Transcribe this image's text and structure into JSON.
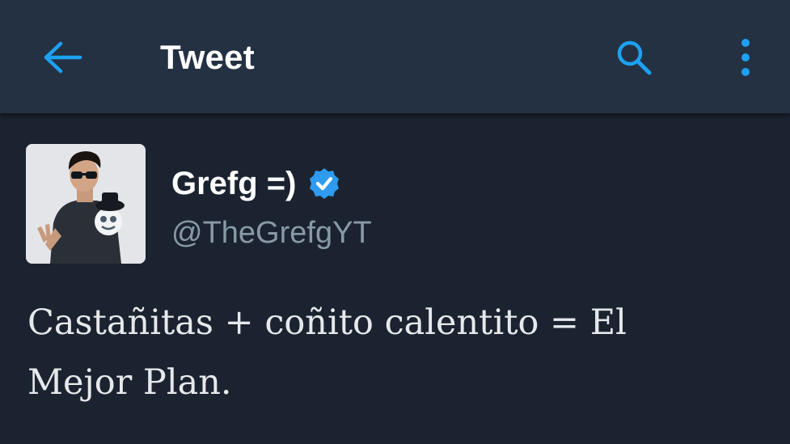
{
  "header": {
    "back_icon": "arrow-left-icon",
    "title": "Tweet",
    "search_icon": "search-icon",
    "more_icon": "vertical-dots-icon"
  },
  "tweet": {
    "author": {
      "display_name": "Grefg =)",
      "handle": "@TheGrefgYT",
      "verified": true,
      "verified_icon": "verified-badge-icon"
    },
    "text_line_1": "Castañitas + coñito calentito = El",
    "text_line_2": "Mejor Plan."
  },
  "colors": {
    "topbar_bg": "#243142",
    "page_bg": "#1b2330",
    "accent": "#1da1f2",
    "verified_badge": "#2e9bf0",
    "handle_text": "#8899a6",
    "text": "#e6e9ec"
  }
}
